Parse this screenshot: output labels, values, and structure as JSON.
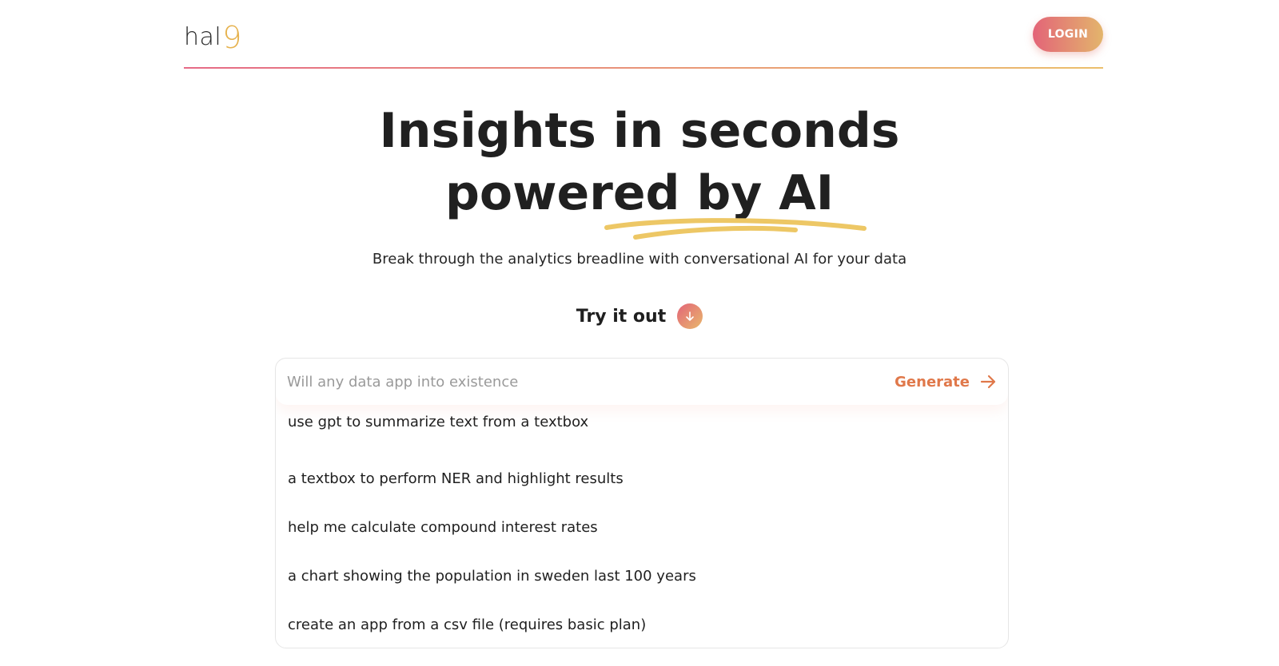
{
  "header": {
    "logo_text": "hal",
    "logo_nine": "9",
    "login_label": "LOGIN"
  },
  "hero": {
    "title_line1": "Insights in seconds",
    "title_line2": "powered by AI",
    "subtitle": "Break through the analytics breadline with conversational AI for your data",
    "try_label": "Try it out",
    "try_icon": "arrow-down-icon"
  },
  "prompt": {
    "placeholder": "Will any data app into existence",
    "value": "",
    "generate_label": "Generate",
    "generate_icon": "arrow-right-icon"
  },
  "suggestions": [
    "use gpt to summarize text from a textbox",
    "a textbox to perform NER and highlight results",
    "help me calculate compound interest rates",
    "a chart showing the population in sweden last 100 years",
    "create an app from a csv file (requires basic plan)"
  ],
  "colors": {
    "accent_start": "#e36478",
    "accent_end": "#e3b56c",
    "generate": "#e0784a",
    "underline": "#edc765"
  }
}
